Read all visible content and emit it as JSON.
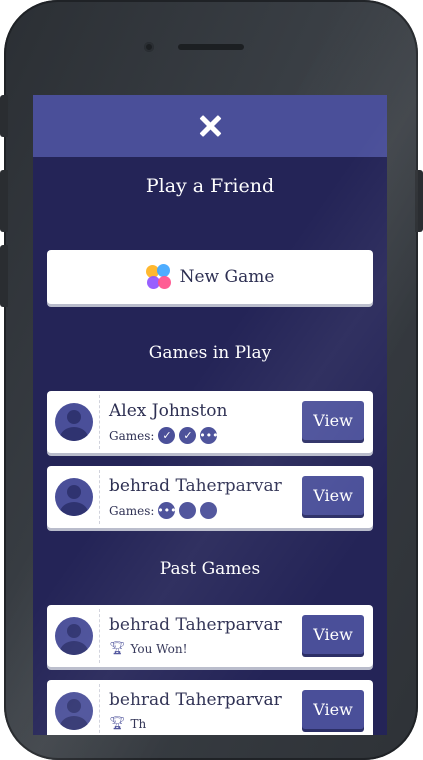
{
  "screen": {
    "close_icon": "close-icon",
    "title": "Play a Friend",
    "new_game": {
      "label": "New Game",
      "icon": "game-center-icon"
    },
    "games_in_play_heading": "Games in Play",
    "past_games_heading": "Past Games",
    "games_in_play": [
      {
        "name": "Alex Johnston",
        "status_label": "Games:",
        "turns": [
          "check",
          "check",
          "pending"
        ],
        "view_label": "View"
      },
      {
        "name": "behrad Taherparvar",
        "status_label": "Games:",
        "turns": [
          "pending",
          "empty",
          "empty"
        ],
        "view_label": "View"
      }
    ],
    "past_games": [
      {
        "name": "behrad Taherparvar",
        "result": "You Won!",
        "icon": "trophy-icon",
        "view_label": "View"
      },
      {
        "name": "behrad Taherparvar",
        "result": "Th",
        "icon": "trophy-icon",
        "view_label": "View"
      }
    ]
  },
  "colors": {
    "background": "#242457",
    "header": "#4a4f99",
    "accent": "#4a4f99",
    "card": "#ffffff",
    "phone_frame": "#33373c"
  }
}
